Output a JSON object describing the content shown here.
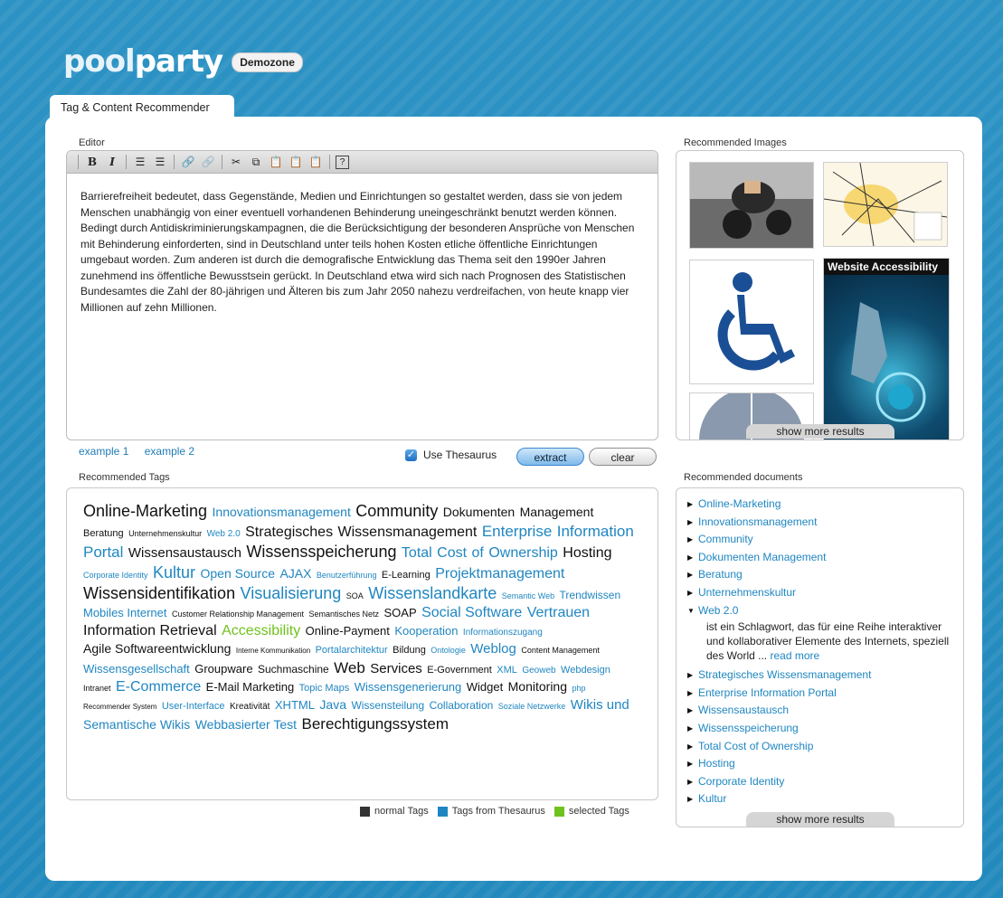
{
  "logo": {
    "part1": "pool",
    "part2": "party",
    "badge": "Demozone"
  },
  "tab": {
    "label": "Tag & Content Recommender"
  },
  "editor": {
    "label": "Editor",
    "text": "Barrierefreiheit bedeutet, dass Gegenstände, Medien und Einrichtungen so gestaltet werden, dass sie von jedem Menschen unabhängig von einer eventuell vorhandenen Behinderung uneingeschränkt benutzt werden können. Bedingt durch Antidiskriminierungskampagnen, die die Berücksichtigung der besonderen Ansprüche von Menschen mit Behinderung einforderten, sind in Deutschland unter teils hohen Kosten etliche öffentliche Einrichtungen umgebaut worden. Zum anderen ist durch die demografische Entwicklung das Thema seit den 1990er Jahren zunehmend ins öffentliche Bewusstsein gerückt. In Deutschland etwa wird sich nach Prognosen des Statistischen Bundesamtes die Zahl der 80-jährigen und Älteren bis zum Jahr 2050 nahezu verdreifachen, von heute knapp vier Millionen auf zehn Millionen.",
    "toolbar": {
      "bold": "B",
      "italic": "I"
    }
  },
  "examples": [
    "example 1",
    "example 2"
  ],
  "thesaurus": {
    "checked": true,
    "label": "Use Thesaurus"
  },
  "buttons": {
    "extract": "extract",
    "clear": "clear"
  },
  "tags_label": "Recommended Tags",
  "tags": [
    {
      "t": "Online-Marketing",
      "s": 18,
      "k": "n"
    },
    {
      "t": "Innovationsmanagement",
      "s": 14,
      "k": "t"
    },
    {
      "t": "Community",
      "s": 18,
      "k": "n"
    },
    {
      "t": "Dokumenten",
      "s": 14,
      "k": "n"
    },
    {
      "t": "Management",
      "s": 14,
      "k": "n"
    },
    {
      "t": "Beratung",
      "s": 11,
      "k": "n"
    },
    {
      "t": "Unternehmenskultur",
      "s": 9,
      "k": "n"
    },
    {
      "t": "Web 2.0",
      "s": 10,
      "k": "t"
    },
    {
      "t": "Strategisches",
      "s": 16,
      "k": "n"
    },
    {
      "t": "Wissensmanagement",
      "s": 16,
      "k": "n"
    },
    {
      "t": "Enterprise",
      "s": 17,
      "k": "t"
    },
    {
      "t": "Information",
      "s": 17,
      "k": "t"
    },
    {
      "t": "Portal",
      "s": 17,
      "k": "t"
    },
    {
      "t": "Wissensaustausch",
      "s": 15,
      "k": "n"
    },
    {
      "t": "Wissensspeicherung",
      "s": 18,
      "k": "n"
    },
    {
      "t": "Total",
      "s": 16,
      "k": "t"
    },
    {
      "t": "Cost",
      "s": 16,
      "k": "t"
    },
    {
      "t": "of",
      "s": 16,
      "k": "t"
    },
    {
      "t": "Ownership",
      "s": 16,
      "k": "t"
    },
    {
      "t": "Hosting",
      "s": 16,
      "k": "n"
    },
    {
      "t": "Corporate Identity",
      "s": 9,
      "k": "t"
    },
    {
      "t": "Kultur",
      "s": 18,
      "k": "t"
    },
    {
      "t": "Open Source",
      "s": 14,
      "k": "t"
    },
    {
      "t": "AJAX",
      "s": 14,
      "k": "t"
    },
    {
      "t": "Benutzerführung",
      "s": 9,
      "k": "t"
    },
    {
      "t": "E-Learning",
      "s": 11,
      "k": "n"
    },
    {
      "t": "Projektmanagement",
      "s": 16,
      "k": "t"
    },
    {
      "t": "Wissensidentifikation",
      "s": 18,
      "k": "n"
    },
    {
      "t": "Visualisierung",
      "s": 18,
      "k": "t"
    },
    {
      "t": "SOA",
      "s": 9,
      "k": "n"
    },
    {
      "t": "Wissenslandkarte",
      "s": 18,
      "k": "t"
    },
    {
      "t": "Semantic Web",
      "s": 9,
      "k": "t"
    },
    {
      "t": "Trendwissen",
      "s": 12,
      "k": "t"
    },
    {
      "t": "Mobiles Internet",
      "s": 13,
      "k": "t"
    },
    {
      "t": "Customer Relationship Management",
      "s": 9,
      "k": "n"
    },
    {
      "t": "Semantisches Netz",
      "s": 9,
      "k": "n"
    },
    {
      "t": "SOAP",
      "s": 13,
      "k": "n"
    },
    {
      "t": "Social Software",
      "s": 16,
      "k": "t"
    },
    {
      "t": "Vertrauen",
      "s": 16,
      "k": "t"
    },
    {
      "t": "Information Retrieval",
      "s": 16,
      "k": "n"
    },
    {
      "t": "Accessibility",
      "s": 16,
      "k": "s"
    },
    {
      "t": "Online-Payment",
      "s": 13,
      "k": "n"
    },
    {
      "t": "Kooperation",
      "s": 13,
      "k": "t"
    },
    {
      "t": "Informationszugang",
      "s": 10,
      "k": "t"
    },
    {
      "t": "Agile Softwareentwicklung",
      "s": 14,
      "k": "n"
    },
    {
      "t": "Interne Kommunikation",
      "s": 8,
      "k": "n"
    },
    {
      "t": "Portalarchitektur",
      "s": 11,
      "k": "t"
    },
    {
      "t": "Bildung",
      "s": 11,
      "k": "n"
    },
    {
      "t": "Ontologie",
      "s": 9,
      "k": "t"
    },
    {
      "t": "Weblog",
      "s": 15,
      "k": "t"
    },
    {
      "t": "Content Management",
      "s": 9,
      "k": "n"
    },
    {
      "t": "Wissensgesellschaft",
      "s": 13,
      "k": "t"
    },
    {
      "t": "Groupware",
      "s": 13,
      "k": "n"
    },
    {
      "t": "Suchmaschine",
      "s": 12,
      "k": "n"
    },
    {
      "t": "Web",
      "s": 17,
      "k": "n"
    },
    {
      "t": "Services",
      "s": 15,
      "k": "n"
    },
    {
      "t": "E-Government",
      "s": 11,
      "k": "n"
    },
    {
      "t": "XML",
      "s": 11,
      "k": "t"
    },
    {
      "t": "Geoweb",
      "s": 10,
      "k": "t"
    },
    {
      "t": "Webdesign",
      "s": 11,
      "k": "t"
    },
    {
      "t": "Intranet",
      "s": 9,
      "k": "n"
    },
    {
      "t": "E-Commerce",
      "s": 16,
      "k": "t"
    },
    {
      "t": "E-Mail Marketing",
      "s": 13,
      "k": "n"
    },
    {
      "t": "Topic Maps",
      "s": 11,
      "k": "t"
    },
    {
      "t": "Wissensgenerierung",
      "s": 13,
      "k": "t"
    },
    {
      "t": "Widget",
      "s": 13,
      "k": "n"
    },
    {
      "t": "Monitoring",
      "s": 14,
      "k": "n"
    },
    {
      "t": "php",
      "s": 9,
      "k": "t"
    },
    {
      "t": "Recommender System",
      "s": 8,
      "k": "n"
    },
    {
      "t": "User-Interface",
      "s": 11,
      "k": "t"
    },
    {
      "t": "Kreativität",
      "s": 10,
      "k": "n"
    },
    {
      "t": "XHTML",
      "s": 13,
      "k": "t"
    },
    {
      "t": "Java",
      "s": 14,
      "k": "t"
    },
    {
      "t": "Wissensteilung",
      "s": 12,
      "k": "t"
    },
    {
      "t": "Collaboration",
      "s": 12,
      "k": "t"
    },
    {
      "t": "Soziale Netzwerke",
      "s": 9,
      "k": "t"
    },
    {
      "t": "Wikis und",
      "s": 15,
      "k": "t"
    },
    {
      "t": "Semantische Wikis",
      "s": 14,
      "k": "t"
    },
    {
      "t": "Webbasierter Test",
      "s": 14,
      "k": "t"
    },
    {
      "t": "Berechtigungssystem",
      "s": 17,
      "k": "n"
    }
  ],
  "legend": {
    "normal": "normal Tags",
    "thesaurus": "Tags from Thesaurus",
    "selected": "selected Tags",
    "colors": {
      "normal": "#333333",
      "thesaurus": "#1f86c1",
      "selected": "#6fc21e"
    }
  },
  "images": {
    "label": "Recommended Images",
    "more": "show more results",
    "accessibility_title": "Website Accessibility"
  },
  "documents": {
    "label": "Recommended documents",
    "more": "show more results",
    "items": [
      {
        "label": "Online-Marketing"
      },
      {
        "label": "Innovationsmanagement"
      },
      {
        "label": "Community"
      },
      {
        "label": "Dokumenten Management"
      },
      {
        "label": "Beratung"
      },
      {
        "label": "Unternehmenskultur"
      },
      {
        "label": "Web 2.0",
        "expanded": true,
        "desc": "ist ein Schlagwort, das für eine Reihe interaktiver und kollaborativer Elemente des Internets, speziell des World ...",
        "read_more": "read more"
      },
      {
        "label": "Strategisches Wissensmanagement"
      },
      {
        "label": "Enterprise Information Portal"
      },
      {
        "label": "Wissensaustausch"
      },
      {
        "label": "Wissensspeicherung"
      },
      {
        "label": "Total Cost of Ownership"
      },
      {
        "label": "Hosting"
      },
      {
        "label": "Corporate Identity"
      },
      {
        "label": "Kultur"
      }
    ]
  }
}
